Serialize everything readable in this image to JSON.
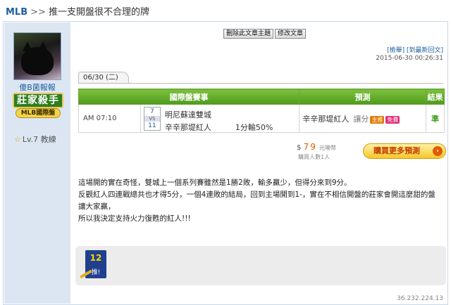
{
  "breadcrumb": {
    "section": "MLB",
    "separator": ">>",
    "topic": "推一支開盤很不合理的牌"
  },
  "author": {
    "name": "傻B菌報報",
    "medal_top": "莊家殺手",
    "medal_bottom": "MLB國際盤",
    "level": "Lv.7 教練"
  },
  "toolbar": {
    "delete_label": "刪除此文章主題",
    "edit_label": "修改文章"
  },
  "post_links": {
    "report": "[檢舉]",
    "refresh": "[到最新回文]"
  },
  "post_time": "2015-06-30 00:26:31",
  "date_tab": "06/30 (二)",
  "table": {
    "headers": {
      "game": "國際盤賽事",
      "prediction": "預測",
      "result": "結果"
    },
    "row": {
      "time": "AM 07:10",
      "score_top": "7",
      "vs": "VS",
      "score_bottom": "11",
      "team_away": "明尼蘇達雙城",
      "team_home": "辛辛那堤紅人",
      "handicap": "1分輸50%",
      "pred_team": "辛辛那堤紅人",
      "pred_type": "讓分",
      "tag_main": "主推",
      "tag_extra": "免費",
      "result": "準"
    }
  },
  "purchase": {
    "currency": "$",
    "price": "79",
    "unit": "元噢幣",
    "buyers": "購買人數1人",
    "button_label": "購買更多預測"
  },
  "content": [
    "這場開的實在奇怪，雙城上一個系列賽雖然是1勝2敗，輸多贏少，但得分來到9分。",
    "反觀紅人四連戰總共也才得5分，一個4連敗的結局，回到主場開到1-，實在不相信開盤的莊家會開這麼甜的盤讓大家贏，",
    "所以我決定支持火力復甦的紅人!!!"
  ],
  "signature": {
    "badge_number": "12",
    "badge_label": "推!"
  },
  "ip": "36.232.224.13"
}
